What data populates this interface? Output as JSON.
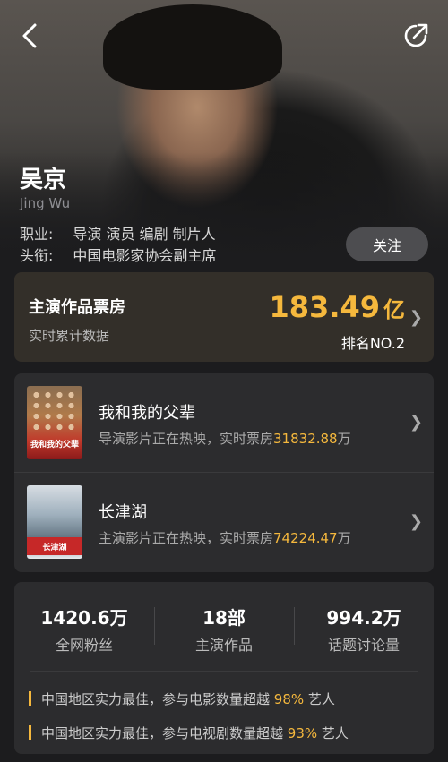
{
  "person": {
    "name": "吴京",
    "name_en": "Jing Wu",
    "occupation_label": "职业:",
    "occupation": "导演 演员 编剧 制片人",
    "title_label": "头衔:",
    "title": "中国电影家协会副主席",
    "follow_label": "关注"
  },
  "box_office": {
    "title": "主演作品票房",
    "subtitle": "实时累计数据",
    "value": "183.49",
    "unit": "亿",
    "rank": "排名NO.2"
  },
  "films": [
    {
      "title": "我和我的父辈",
      "desc_prefix": "导演影片正在热映，实时票房",
      "box": "31832.88",
      "unit": "万",
      "poster_text": "我和我的父辈"
    },
    {
      "title": "长津湖",
      "desc_prefix": "主演影片正在热映，实时票房",
      "box": "74224.47",
      "unit": "万",
      "poster_text": "长津湖"
    }
  ],
  "stats": [
    {
      "value": "1420.6万",
      "label": "全网粉丝"
    },
    {
      "value": "18部",
      "label": "主演作品"
    },
    {
      "value": "994.2万",
      "label": "话题讨论量"
    }
  ],
  "facts": [
    {
      "prefix": "中国地区实力最佳，参与电影数量超越 ",
      "percent": "98%",
      "suffix": " 艺人"
    },
    {
      "prefix": "中国地区实力最佳，参与电视剧数量超越 ",
      "percent": "93%",
      "suffix": " 艺人"
    }
  ],
  "colors": {
    "accent": "#f5b83d",
    "background": "#1c1c1e",
    "card": "#2c2c2e"
  },
  "icons": {
    "back": "chevron-left-icon",
    "share": "share-icon",
    "chevron": "chevron-right-icon"
  }
}
